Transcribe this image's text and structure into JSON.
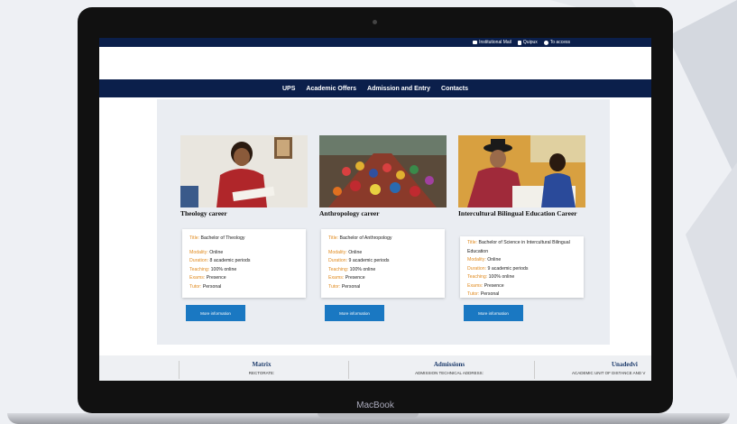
{
  "device": {
    "brand_label": "MacBook"
  },
  "topbar": {
    "links": [
      {
        "icon": "mail-icon",
        "label": "Institutional Mail"
      },
      {
        "icon": "document-icon",
        "label": "Quipux"
      },
      {
        "icon": "user-icon",
        "label": "To access"
      }
    ]
  },
  "nav": {
    "items": [
      "UPS",
      "Academic Offers",
      "Admission and Entry",
      "Contacts"
    ]
  },
  "cards": [
    {
      "title": "Theology career",
      "degree_label": "Title:",
      "degree": "Bachelor of Theology",
      "modality_label": "Modality:",
      "modality": "Online",
      "duration_label": "Duration:",
      "duration": "8 academic periods",
      "teaching_label": "Teaching:",
      "teaching": "100% online",
      "exams_label": "Exams:",
      "exams": "Presence",
      "tutor_label": "Tutor:",
      "tutor": "Personal",
      "button": "More information"
    },
    {
      "title": "Anthropology career",
      "degree_label": "Title:",
      "degree": "Bachelor of Anthropology",
      "modality_label": "Modality:",
      "modality": "Online",
      "duration_label": "Duration:",
      "duration": "9 academic periods",
      "teaching_label": "Teaching:",
      "teaching": "100% online",
      "exams_label": "Exams:",
      "exams": "Presence",
      "tutor_label": "Tutor:",
      "tutor": "Personal",
      "button": "More information"
    },
    {
      "title": "Intercultural Bilingual Education Career",
      "degree_label": "Title:",
      "degree": "Bachelor of Science in Intercultural Bilingual Education",
      "modality_label": "Modality:",
      "modality": "Online",
      "duration_label": "Duration:",
      "duration": "9 academic periods",
      "teaching_label": "Teaching:",
      "teaching": "100% online",
      "exams_label": "Exams:",
      "exams": "Presence",
      "tutor_label": "Tutor:",
      "tutor": "Personal",
      "button": "More information"
    }
  ],
  "footer": {
    "columns": [
      {
        "heading": "Matrix",
        "sub": "RECTORATE:"
      },
      {
        "heading": "Admissions",
        "sub": "ADMISSION TECHNICAL ADDRESS:"
      },
      {
        "heading": "Unadedvi",
        "sub": "ACADEMIC UNIT OF DISTANCE AND V"
      }
    ]
  },
  "colors": {
    "navy": "#0b1f4b",
    "accent_orange": "#e08a1e",
    "button_blue": "#1a78c2"
  }
}
